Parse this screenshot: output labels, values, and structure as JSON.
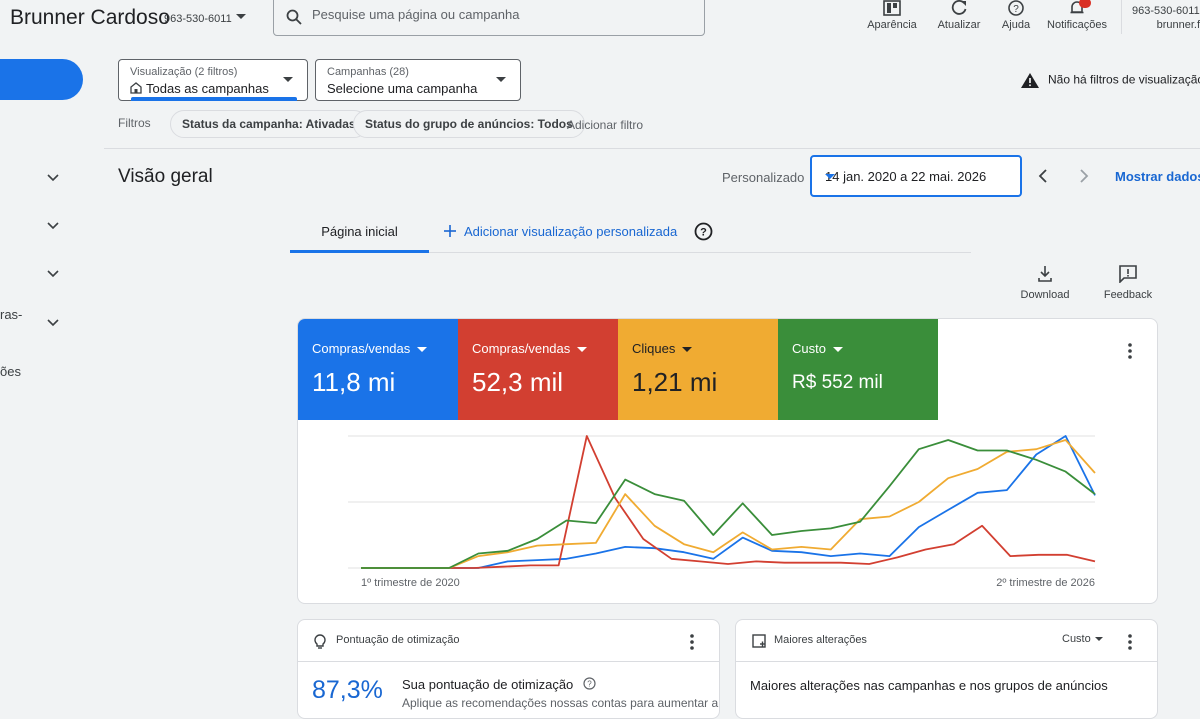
{
  "header": {
    "account_name": "Brunner Cardoso",
    "account_id": "963-530-6011",
    "search_placeholder": "Pesquise uma página ou campanha",
    "tools": [
      {
        "label": "Aparência",
        "icon": "appearance-icon"
      },
      {
        "label": "Atualizar",
        "icon": "refresh-icon"
      },
      {
        "label": "Ajuda",
        "icon": "help-icon"
      },
      {
        "label": "Notificações",
        "icon": "bell-icon"
      }
    ],
    "account_right_id": "963-530-6011",
    "account_right_name": "brunner.f"
  },
  "sidebar": {
    "partial_labels": [
      "ras-",
      "ões"
    ]
  },
  "filters": {
    "view": {
      "label": "Visualização (2 filtros)",
      "value": "Todas as campanhas"
    },
    "campaigns": {
      "label": "Campanhas (28)",
      "value": "Selecione uma campanha"
    },
    "warning": "Não há filtros de visualização a",
    "filtros_label": "Filtros",
    "chips": [
      "Status da campanha: Ativadas",
      "Status do grupo de anúncios: Todos"
    ],
    "add_filter": "Adicionar filtro"
  },
  "overview": {
    "title": "Visão geral",
    "date_mode": "Personalizado",
    "date_range": "14 jan. 2020 a 22 mai. 2026",
    "show_data": "Mostrar dados"
  },
  "tabs": {
    "home": "Página inicial",
    "add_custom": "Adicionar visualização personalizada"
  },
  "actions": {
    "download": "Download",
    "feedback": "Feedback"
  },
  "metrics": [
    {
      "label": "Compras/vendas",
      "value": "11,8 mi",
      "color": "#1a73e8"
    },
    {
      "label": "Compras/vendas",
      "value": "52,3 mil",
      "color": "#d23f31"
    },
    {
      "label": "Cliques",
      "value": "1,21 mi",
      "color": "#f0ab32"
    },
    {
      "label": "Custo",
      "value": "R$ 552 mil",
      "color": "#3a8e3a"
    }
  ],
  "chart_data": {
    "type": "line",
    "x_labels": [
      "1º trimestre de 2020",
      "2º trimestre de 2026"
    ],
    "series": [
      {
        "color": "#1a73e8",
        "values": [
          0,
          0,
          0,
          0,
          0,
          5,
          6,
          7,
          11,
          16,
          15,
          12,
          7,
          23,
          13,
          12,
          9,
          11,
          9,
          31,
          44,
          57,
          59,
          86,
          100,
          55
        ]
      },
      {
        "color": "#d23f31",
        "values": [
          0,
          0,
          0,
          0,
          0,
          1,
          2,
          2,
          100,
          53,
          22,
          7,
          5,
          3,
          5,
          4,
          4,
          4,
          3,
          8,
          14,
          18,
          32,
          9,
          10,
          10,
          5
        ]
      },
      {
        "color": "#f0ab32",
        "values": [
          0,
          0,
          0,
          0,
          9,
          12,
          17,
          18,
          19,
          56,
          32,
          18,
          12,
          27,
          14,
          16,
          14,
          37,
          39,
          50,
          68,
          75,
          88,
          90,
          97,
          72
        ]
      },
      {
        "color": "#3a8e3a",
        "values": [
          0,
          0,
          0,
          0,
          11,
          13,
          22,
          36,
          34,
          67,
          56,
          51,
          25,
          49,
          25,
          28,
          30,
          35,
          62,
          90,
          97,
          89,
          89,
          82,
          73,
          56
        ]
      }
    ],
    "grid": true,
    "ylim": [
      0,
      100
    ]
  },
  "optimization": {
    "title": "Pontuação de otimização",
    "score": "87,3%",
    "heading": "Sua pontuação de otimização",
    "sub": "Aplique as recomendações nossas contas para aumentar a"
  },
  "changes": {
    "title": "Maiores alterações",
    "dropdown": "Custo",
    "heading": "Maiores alterações nas campanhas e nos grupos de anúncios"
  }
}
